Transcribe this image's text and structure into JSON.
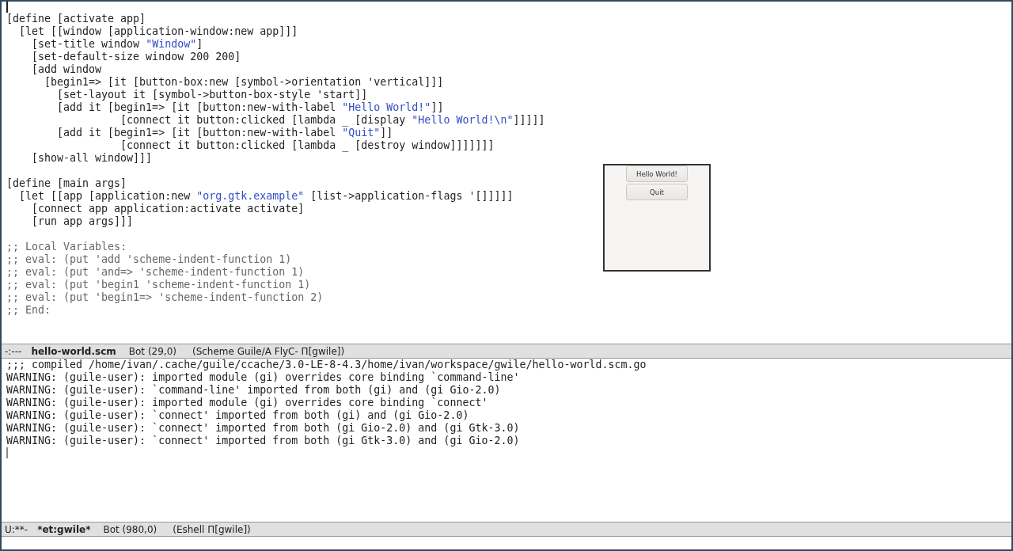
{
  "editor": {
    "lines": [
      {
        "kind": "code",
        "segments": [
          {
            "kind": "code",
            "text": "[define [activate app]"
          }
        ]
      },
      {
        "kind": "code",
        "segments": [
          {
            "kind": "code",
            "text": "  [let [[window [application-window:new app]]]"
          }
        ]
      },
      {
        "kind": "code",
        "segments": [
          {
            "kind": "code",
            "text": "    [set-title window "
          },
          {
            "kind": "string",
            "text": "\"Window\""
          },
          {
            "kind": "code",
            "text": "]"
          }
        ]
      },
      {
        "kind": "code",
        "segments": [
          {
            "kind": "code",
            "text": "    [set-default-size window 200 200]"
          }
        ]
      },
      {
        "kind": "code",
        "segments": [
          {
            "kind": "code",
            "text": "    [add window"
          }
        ]
      },
      {
        "kind": "code",
        "segments": [
          {
            "kind": "code",
            "text": "      [begin1=> [it [button-box:new [symbol->orientation 'vertical]]]"
          }
        ]
      },
      {
        "kind": "code",
        "segments": [
          {
            "kind": "code",
            "text": "        [set-layout it [symbol->button-box-style 'start]]"
          }
        ]
      },
      {
        "kind": "code",
        "segments": [
          {
            "kind": "code",
            "text": "        [add it [begin1=> [it [button:new-with-label "
          },
          {
            "kind": "string",
            "text": "\"Hello World!\""
          },
          {
            "kind": "code",
            "text": "]]"
          }
        ]
      },
      {
        "kind": "code",
        "segments": [
          {
            "kind": "code",
            "text": "                  [connect it button:clicked [lambda _ [display "
          },
          {
            "kind": "string",
            "text": "\"Hello World!\\n\""
          },
          {
            "kind": "code",
            "text": "]]]]]"
          }
        ]
      },
      {
        "kind": "code",
        "segments": [
          {
            "kind": "code",
            "text": "        [add it [begin1=> [it [button:new-with-label "
          },
          {
            "kind": "string",
            "text": "\"Quit\""
          },
          {
            "kind": "code",
            "text": "]]"
          }
        ]
      },
      {
        "kind": "code",
        "segments": [
          {
            "kind": "code",
            "text": "                  [connect it button:clicked [lambda _ [destroy window]]]]]]]"
          }
        ]
      },
      {
        "kind": "code",
        "segments": [
          {
            "kind": "code",
            "text": "    [show-all window]]]"
          }
        ]
      },
      {
        "kind": "blank"
      },
      {
        "kind": "code",
        "segments": [
          {
            "kind": "code",
            "text": "[define [main args]"
          }
        ]
      },
      {
        "kind": "code",
        "segments": [
          {
            "kind": "code",
            "text": "  [let [[app [application:new "
          },
          {
            "kind": "string",
            "text": "\"org.gtk.example\""
          },
          {
            "kind": "code",
            "text": " [list->application-flags '[]]]]]"
          }
        ]
      },
      {
        "kind": "code",
        "segments": [
          {
            "kind": "code",
            "text": "    [connect app application:activate activate]"
          }
        ]
      },
      {
        "kind": "code",
        "segments": [
          {
            "kind": "code",
            "text": "    [run app args]]]"
          }
        ]
      },
      {
        "kind": "blank"
      },
      {
        "kind": "code",
        "segments": [
          {
            "kind": "comment",
            "text": ";; Local Variables:"
          }
        ]
      },
      {
        "kind": "code",
        "segments": [
          {
            "kind": "comment",
            "text": ";; eval: (put 'add 'scheme-indent-function 1)"
          }
        ]
      },
      {
        "kind": "code",
        "segments": [
          {
            "kind": "comment",
            "text": ";; eval: (put 'and=> 'scheme-indent-function 1)"
          }
        ]
      },
      {
        "kind": "code",
        "segments": [
          {
            "kind": "comment",
            "text": ";; eval: (put 'begin1 'scheme-indent-function 1)"
          }
        ]
      },
      {
        "kind": "code",
        "segments": [
          {
            "kind": "comment",
            "text": ";; eval: (put 'begin1=> 'scheme-indent-function 2)"
          }
        ]
      },
      {
        "kind": "code",
        "segments": [
          {
            "kind": "comment",
            "text": ";; End:"
          }
        ]
      }
    ]
  },
  "preview_window": {
    "buttons": [
      "Hello World!",
      "Quit"
    ]
  },
  "mode_line_top": {
    "status": "-:---",
    "buffer": "hello-world.scm",
    "position": "Bot (29,0)",
    "modes": "(Scheme Guile/A FlyC- Π[gwile])"
  },
  "shell": {
    "lines": [
      ";;; compiled /home/ivan/.cache/guile/ccache/3.0-LE-8-4.3/home/ivan/workspace/gwile/hello-world.scm.go",
      "WARNING: (guile-user): imported module (gi) overrides core binding `command-line'",
      "WARNING: (guile-user): `command-line' imported from both (gi) and (gi Gio-2.0)",
      "WARNING: (guile-user): imported module (gi) overrides core binding `connect'",
      "WARNING: (guile-user): `connect' imported from both (gi) and (gi Gio-2.0)",
      "WARNING: (guile-user): `connect' imported from both (gi Gio-2.0) and (gi Gtk-3.0)",
      "WARNING: (guile-user): `connect' imported from both (gi Gtk-3.0) and (gi Gio-2.0)"
    ]
  },
  "mode_line_bottom": {
    "status": "U:**-",
    "buffer": "*et:gwile*",
    "position": "Bot (980,0)",
    "modes": "(Eshell Π[gwile])"
  }
}
